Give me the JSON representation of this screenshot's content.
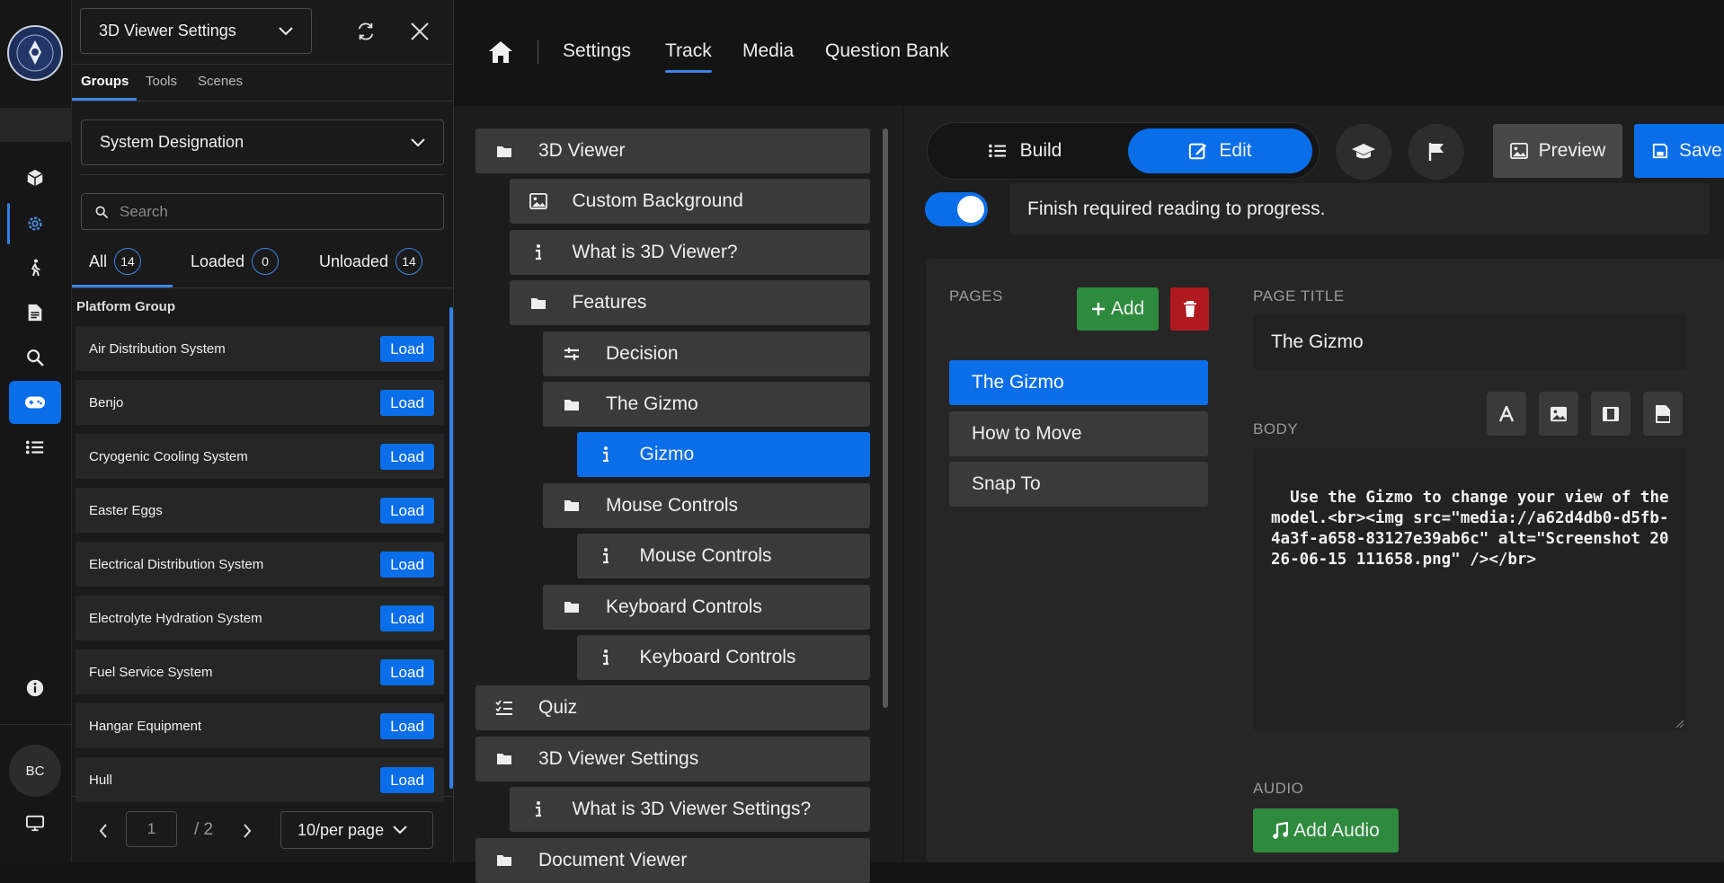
{
  "rail": {
    "items": [
      "cube-icon",
      "gear-icon",
      "walk-icon",
      "document-icon",
      "search-icon",
      "gamepad-icon",
      "list-icon"
    ],
    "info_icon": "info-icon",
    "user_initials": "BC",
    "monitor_icon": "monitor-icon"
  },
  "panel": {
    "title_select": "3D Viewer Settings",
    "tabs": [
      "Groups",
      "Tools",
      "Scenes"
    ],
    "group_select": "System Designation",
    "search_placeholder": "Search",
    "filters": [
      {
        "label": "All",
        "count": "14"
      },
      {
        "label": "Loaded",
        "count": "0"
      },
      {
        "label": "Unloaded",
        "count": "14"
      }
    ],
    "group_header": "Platform Group",
    "load_label": "Load",
    "groups": [
      "Air Distribution System",
      "Benjo",
      "Cryogenic Cooling System",
      "Easter Eggs",
      "Electrical Distribution System",
      "Electrolyte Hydration System",
      "Fuel Service System",
      "Hangar Equipment",
      "Hull"
    ],
    "pager": {
      "current": "1",
      "total": "/ 2",
      "per_page": "10/per page"
    }
  },
  "nav": {
    "links": [
      "Settings",
      "Track",
      "Media",
      "Question Bank"
    ],
    "active": "Track"
  },
  "tree": [
    {
      "label": "3D Viewer",
      "icon": "folder-icon"
    },
    {
      "label": "Custom Background",
      "icon": "image-icon"
    },
    {
      "label": "What is 3D Viewer?",
      "icon": "info-icon"
    },
    {
      "label": "Features",
      "icon": "folder-icon"
    },
    {
      "label": "Decision",
      "icon": "decision-icon"
    },
    {
      "label": "The Gizmo",
      "icon": "folder-icon"
    },
    {
      "label": "Gizmo",
      "icon": "info-icon"
    },
    {
      "label": "Mouse Controls",
      "icon": "folder-icon"
    },
    {
      "label": "Mouse Controls",
      "icon": "info-icon"
    },
    {
      "label": "Keyboard Controls",
      "icon": "folder-icon"
    },
    {
      "label": "Keyboard Controls",
      "icon": "info-icon"
    },
    {
      "label": "Quiz",
      "icon": "checklist-icon"
    },
    {
      "label": "3D Viewer Settings",
      "icon": "folder-icon"
    },
    {
      "label": "What is 3D Viewer Settings?",
      "icon": "info-icon"
    },
    {
      "label": "Document Viewer",
      "icon": "folder-icon"
    }
  ],
  "editor": {
    "build_label": "Build",
    "edit_label": "Edit",
    "preview_label": "Preview",
    "save_label": "Save",
    "toggle_text": "Finish required reading to progress.",
    "pages_label": "PAGES",
    "add_label": "Add",
    "pages": [
      "The Gizmo",
      "How to Move",
      "Snap To"
    ],
    "page_title_label": "PAGE TITLE",
    "page_title_value": "The Gizmo",
    "body_label": "BODY",
    "body_value": "Use the Gizmo to change your view of the model.<br><img src=\"media://a62d4db0-d5fb-4a3f-a658-83127e39ab6c\" alt=\"Screenshot 2026-06-15 111658.png\" /></br>",
    "audio_label": "AUDIO",
    "add_audio_label": "Add Audio"
  },
  "colors": {
    "accent": "#0a6ee8",
    "success": "#2e8b3e",
    "danger": "#b0191e"
  }
}
